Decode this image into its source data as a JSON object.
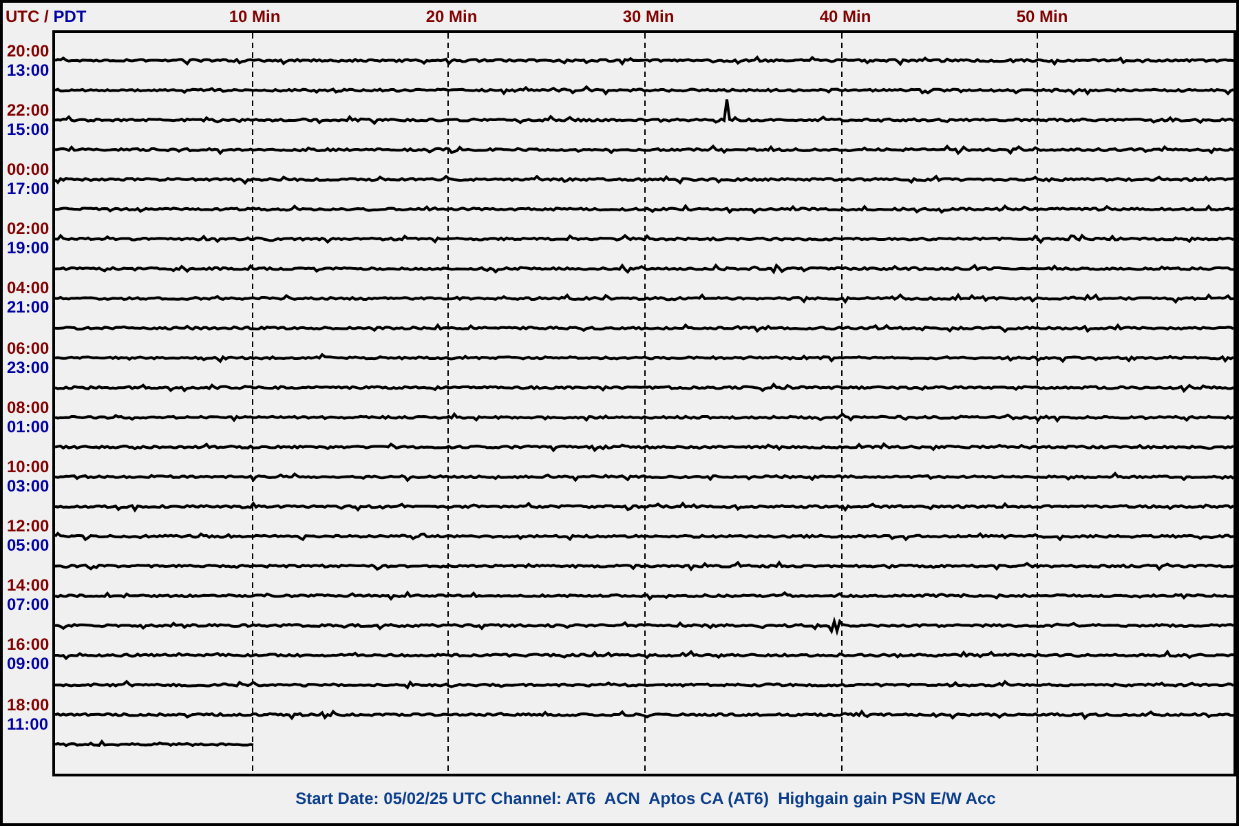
{
  "header": {
    "utc_label": "UTC",
    "separator": "/",
    "pdt_label": "PDT",
    "minute_marks": [
      "10 Min",
      "20 Min",
      "30 Min",
      "40 Min",
      "50 Min"
    ]
  },
  "time_labels": [
    {
      "utc": "20:00",
      "pdt": "13:00"
    },
    {
      "utc": "22:00",
      "pdt": "15:00"
    },
    {
      "utc": "00:00",
      "pdt": "17:00"
    },
    {
      "utc": "02:00",
      "pdt": "19:00"
    },
    {
      "utc": "04:00",
      "pdt": "21:00"
    },
    {
      "utc": "06:00",
      "pdt": "23:00"
    },
    {
      "utc": "08:00",
      "pdt": "01:00"
    },
    {
      "utc": "10:00",
      "pdt": "03:00"
    },
    {
      "utc": "12:00",
      "pdt": "05:00"
    },
    {
      "utc": "14:00",
      "pdt": "07:00"
    },
    {
      "utc": "16:00",
      "pdt": "09:00"
    },
    {
      "utc": "18:00",
      "pdt": "11:00"
    }
  ],
  "partial_trace": {
    "level": 0.17
  },
  "footer": "Start Date: 05/02/25 UTC Channel: AT6  ACN  Aptos CA (AT6)  Highgain gain PSN E/W Acc"
}
